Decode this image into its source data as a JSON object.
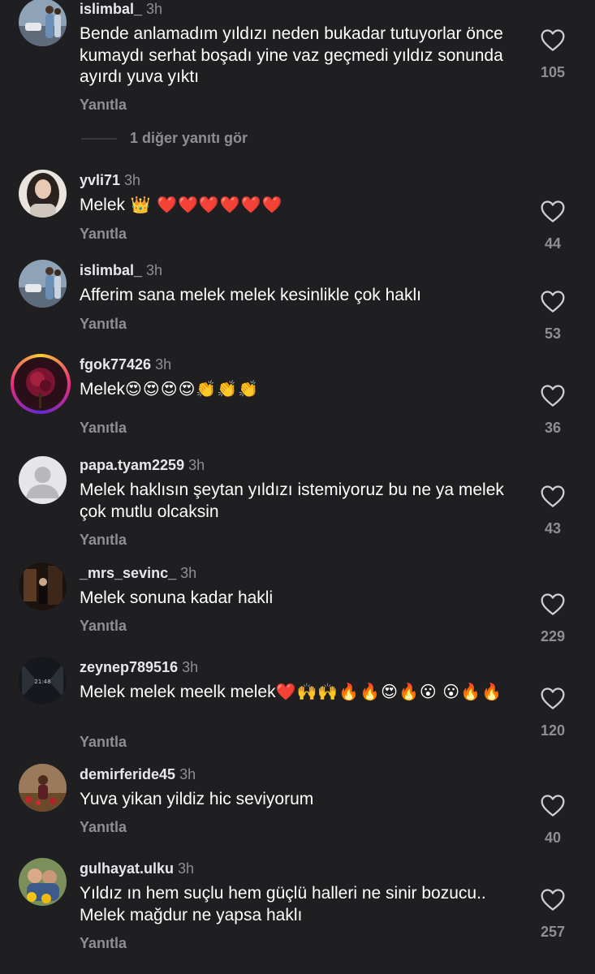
{
  "colors": {
    "background": "#1f1f22",
    "secondary_text": "#8e8e93",
    "heart_outline": "#d0d0d4"
  },
  "reply_label": "Yanıtla",
  "more_replies_label": "1 diğer yanıtı gör",
  "comments": [
    {
      "username": "islimbal_",
      "time": "3h",
      "text": "Bende anlamadım yıldızı neden bukadar tutuyorlar önce kumaydı serhat boşadı yine vaz geçmedi yıldız sonunda ayırdı yuva yıktı",
      "emoji": "",
      "likes": "105"
    },
    {
      "username": "yvli71",
      "time": "3h",
      "text": "Melek",
      "emoji": " 👑  ❤️❤️❤️❤️❤️❤️",
      "likes": "44"
    },
    {
      "username": "islimbal_",
      "time": "3h",
      "text": "Afferim sana melek melek kesinlikle çok haklı",
      "emoji": "",
      "likes": "53"
    },
    {
      "username": "fgok77426",
      "time": "3h",
      "text": "Melek",
      "emoji": "😍😍😍😍👏👏👏",
      "likes": "36"
    },
    {
      "username": "papa.tyam2259",
      "time": "3h",
      "text": "Melek haklısın şeytan yıldızı istemiyoruz bu ne ya melek çok mutlu olcaksin",
      "emoji": "",
      "likes": "43"
    },
    {
      "username": "_mrs_sevinc_",
      "time": "3h",
      "text": "Melek sonuna kadar hakli",
      "emoji": "",
      "likes": "229"
    },
    {
      "username": "zeynep789516",
      "time": "3h",
      "text": "Melek melek meelk melek",
      "emoji": "❤️🙌🙌🔥🔥😍🔥😮 😮🔥🔥",
      "likes": "120"
    },
    {
      "username": "demirferide45",
      "time": "3h",
      "text": "Yuva yikan yildiz hic seviyorum",
      "emoji": "",
      "likes": "40"
    },
    {
      "username": "gulhayat.ulku",
      "time": "3h",
      "text": "Yıldız ın hem suçlu hem güçlü halleri ne sinir bozucu.. Melek mağdur ne yapsa haklı",
      "emoji": "",
      "likes": "257"
    }
  ]
}
